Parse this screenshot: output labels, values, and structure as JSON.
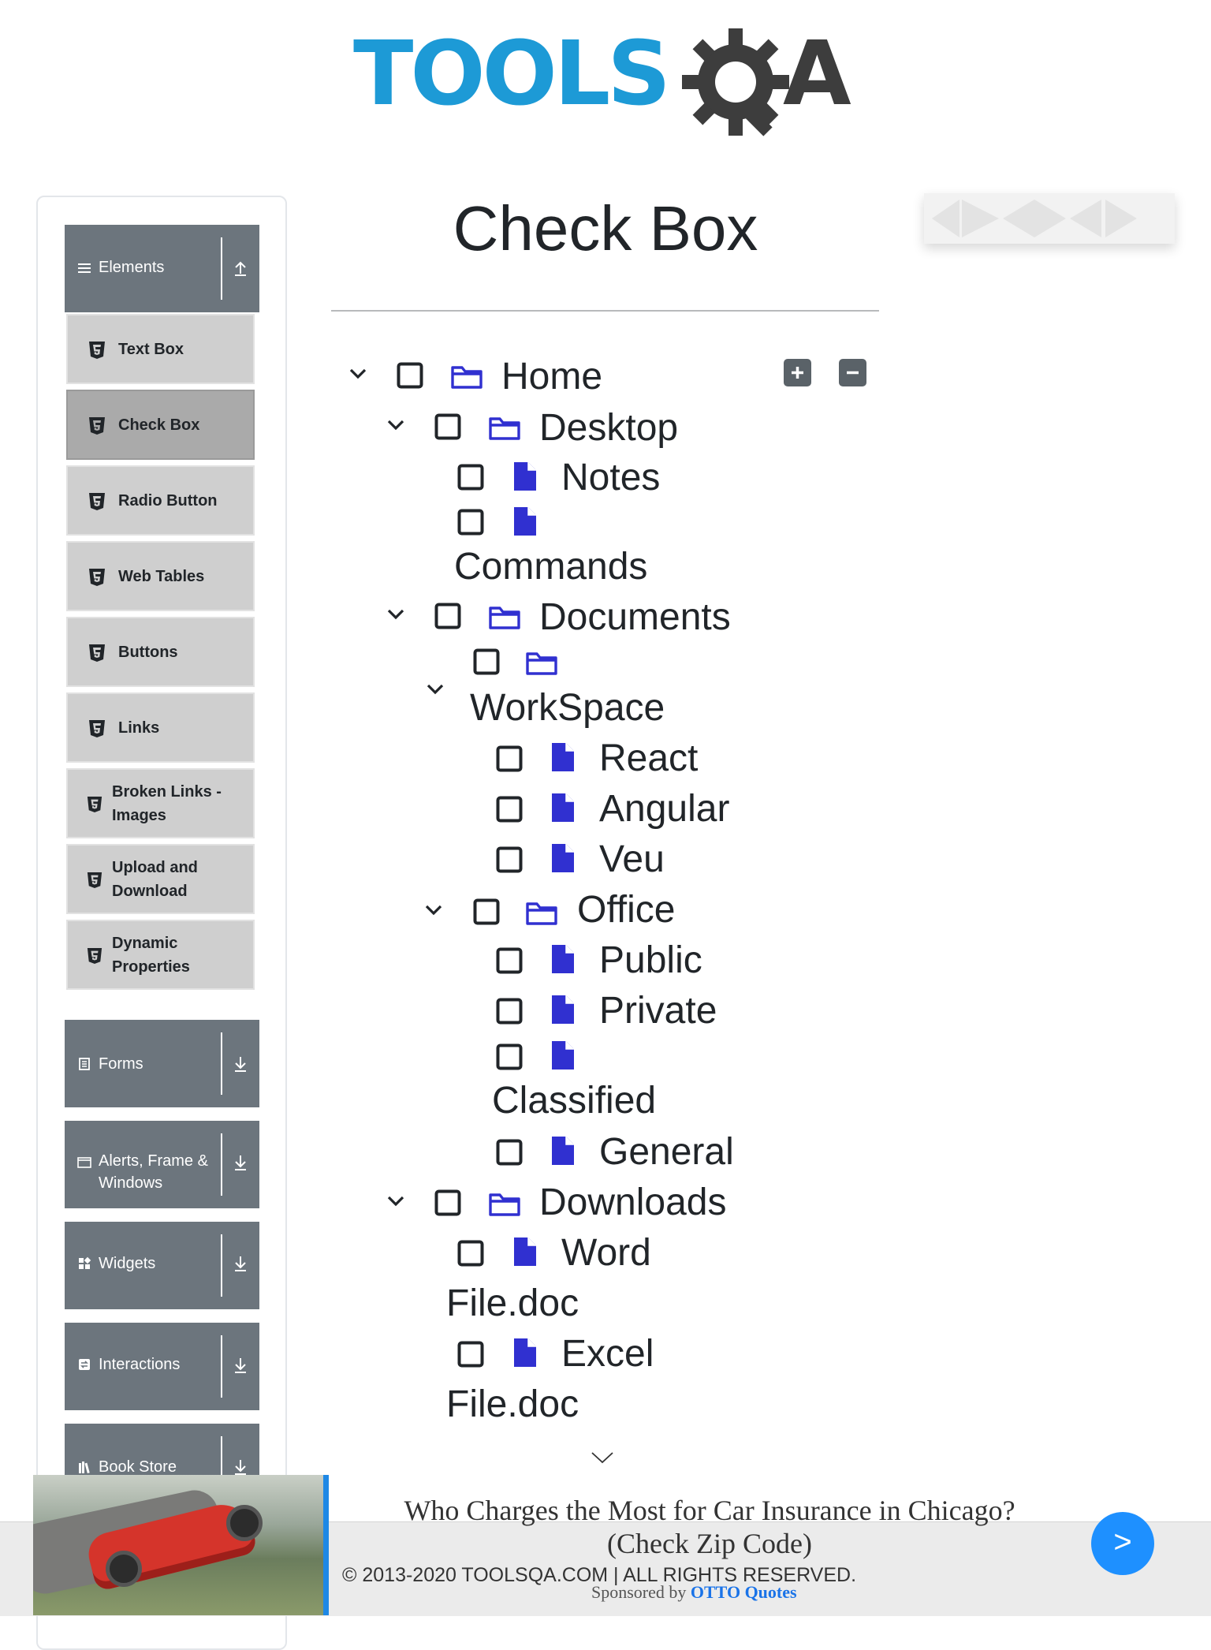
{
  "logo": {
    "text_left": "TOOLS",
    "text_right": "A",
    "colors": {
      "tools": "#1d9ad6",
      "qa": "#3d3d3d"
    }
  },
  "sidebar": {
    "groups": [
      {
        "label": "Elements",
        "icon": "hamburger-icon",
        "state": "expanded"
      },
      {
        "label": "Forms",
        "icon": "form-icon",
        "state": "collapsed"
      },
      {
        "label": "Alerts, Frame & Windows",
        "icon": "window-icon",
        "state": "collapsed"
      },
      {
        "label": "Widgets",
        "icon": "widgets-icon",
        "state": "collapsed"
      },
      {
        "label": "Interactions",
        "icon": "interactions-icon",
        "state": "collapsed"
      },
      {
        "label": "Book Store",
        "icon": "books-icon",
        "state": "collapsed"
      }
    ],
    "elements_items": [
      {
        "label": "Text Box",
        "active": false
      },
      {
        "label": "Check Box",
        "active": true
      },
      {
        "label": "Radio Button",
        "active": false
      },
      {
        "label": "Web Tables",
        "active": false
      },
      {
        "label": "Buttons",
        "active": false
      },
      {
        "label": "Links",
        "active": false
      },
      {
        "label": "Broken Links - Images",
        "active": false
      },
      {
        "label": "Upload and Download",
        "active": false
      },
      {
        "label": "Dynamic Properties",
        "active": false
      }
    ]
  },
  "main": {
    "title": "Check Box",
    "tree_controls": {
      "expand_all_icon": "plus-square-icon",
      "collapse_all_icon": "minus-square-icon"
    },
    "tree": [
      {
        "label": "Home",
        "type": "folder",
        "expanded": true,
        "checked": false
      },
      {
        "label": "Desktop",
        "type": "folder",
        "expanded": true,
        "checked": false
      },
      {
        "label": "Notes",
        "type": "file",
        "checked": false
      },
      {
        "label": "Commands",
        "type": "file",
        "checked": false
      },
      {
        "label": "Documents",
        "type": "folder",
        "expanded": true,
        "checked": false
      },
      {
        "label": "WorkSpace",
        "type": "folder",
        "expanded": true,
        "checked": false
      },
      {
        "label": "React",
        "type": "file",
        "checked": false
      },
      {
        "label": "Angular",
        "type": "file",
        "checked": false
      },
      {
        "label": "Veu",
        "type": "file",
        "checked": false
      },
      {
        "label": "Office",
        "type": "folder",
        "expanded": true,
        "checked": false
      },
      {
        "label": "Public",
        "type": "file",
        "checked": false
      },
      {
        "label": "Private",
        "type": "file",
        "checked": false
      },
      {
        "label": "Classified",
        "type": "file",
        "checked": false
      },
      {
        "label": "General",
        "type": "file",
        "checked": false
      },
      {
        "label": "Downloads",
        "type": "folder",
        "expanded": true,
        "checked": false
      },
      {
        "label": "Word File.doc",
        "type": "file",
        "checked": false
      },
      {
        "label": "Excel File.doc",
        "type": "file",
        "checked": false
      }
    ],
    "colors": {
      "tree_icon": "#3030d0",
      "accent_blue": "#1e90ff"
    }
  },
  "footer": {
    "text": "© 2013-2020 TOOLSQA.COM | ALL RIGHTS RESERVED."
  },
  "ad": {
    "headline": "Who Charges the Most for Car Insurance in Chicago? (Check Zip Code)",
    "sponsored_prefix": "Sponsored by",
    "sponsor": "OTTO Quotes",
    "cta": ">"
  }
}
